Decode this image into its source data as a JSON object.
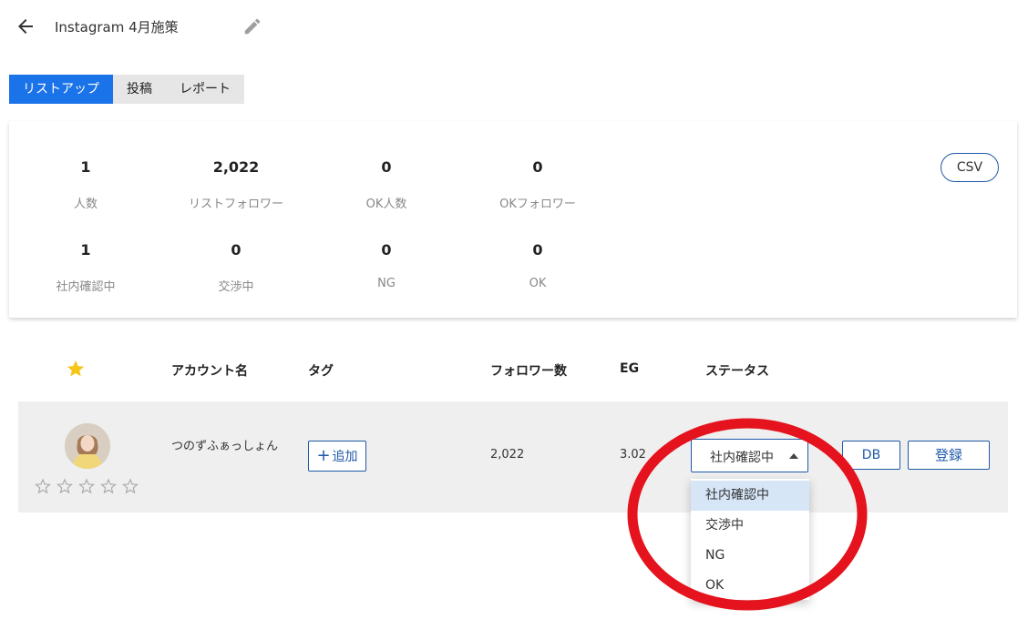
{
  "header": {
    "title": "Instagram 4月施策",
    "back_icon": "arrow-left-icon",
    "edit_icon": "pencil-icon"
  },
  "tabs": [
    {
      "label": "リストアップ",
      "active": true
    },
    {
      "label": "投稿",
      "active": false
    },
    {
      "label": "レポート",
      "active": false
    }
  ],
  "summary": {
    "row1": [
      {
        "value": "1",
        "label": "人数"
      },
      {
        "value": "2,022",
        "label": "リストフォロワー"
      },
      {
        "value": "0",
        "label": "OK人数"
      },
      {
        "value": "0",
        "label": "OKフォロワー"
      }
    ],
    "row2": [
      {
        "value": "1",
        "label": "社内確認中"
      },
      {
        "value": "0",
        "label": "交渉中"
      },
      {
        "value": "0",
        "label": "NG"
      },
      {
        "value": "0",
        "label": "OK"
      }
    ],
    "csv_label": "CSV"
  },
  "table": {
    "headers": {
      "star": "star-icon",
      "account": "アカウント名",
      "tag": "タグ",
      "followers": "フォロワー数",
      "eg": "EG",
      "status": "ステータス"
    },
    "rows": [
      {
        "account_name": "つのずふぁっしょん",
        "tag_button": "追加",
        "followers": "2,022",
        "eg": "3.02 %",
        "status": "社内確認中",
        "rating": 0,
        "rating_max": 5,
        "db_label": "DB",
        "register_label": "登録"
      }
    ]
  },
  "status_options": [
    "社内確認中",
    "交渉中",
    "NG",
    "OK"
  ],
  "colors": {
    "accent": "#1a73e8",
    "border_blue": "#1e5aa8",
    "star": "#f5c518",
    "annotation": "#e4131d"
  }
}
